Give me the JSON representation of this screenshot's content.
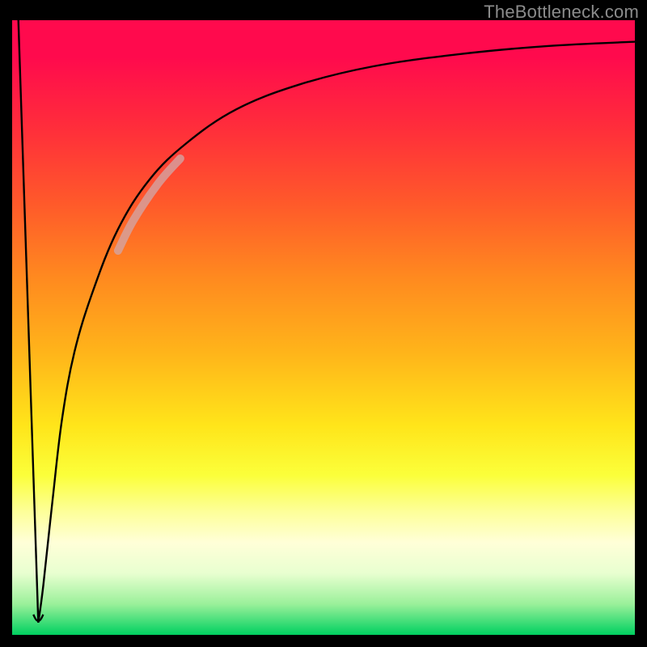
{
  "watermark": "TheBottleneck.com",
  "chart_data": {
    "type": "line",
    "title": "",
    "xlabel": "",
    "ylabel": "",
    "xlim": [
      0,
      100
    ],
    "ylim": [
      0,
      100
    ],
    "gradient_stops": [
      {
        "pct": 0,
        "color": "#ff0a4d"
      },
      {
        "pct": 6,
        "color": "#ff0a4d"
      },
      {
        "pct": 18,
        "color": "#ff2f3a"
      },
      {
        "pct": 30,
        "color": "#ff5a2a"
      },
      {
        "pct": 42,
        "color": "#ff8a1f"
      },
      {
        "pct": 54,
        "color": "#ffb41a"
      },
      {
        "pct": 66,
        "color": "#ffe51a"
      },
      {
        "pct": 74,
        "color": "#fbff3a"
      },
      {
        "pct": 80,
        "color": "#fdff9a"
      },
      {
        "pct": 85,
        "color": "#ffffd8"
      },
      {
        "pct": 90,
        "color": "#e8ffd0"
      },
      {
        "pct": 95,
        "color": "#9af09a"
      },
      {
        "pct": 100,
        "color": "#00d060"
      }
    ],
    "series": [
      {
        "name": "descending-edge",
        "stroke": "#000000",
        "width": 2.4,
        "points": [
          {
            "x": 1.0,
            "y": 100.0
          },
          {
            "x": 4.2,
            "y": 2.0
          }
        ]
      },
      {
        "name": "rising-curve",
        "stroke": "#000000",
        "width": 2.4,
        "points": [
          {
            "x": 4.2,
            "y": 2.0
          },
          {
            "x": 5.0,
            "y": 8.0
          },
          {
            "x": 6.5,
            "y": 22.0
          },
          {
            "x": 8.0,
            "y": 35.0
          },
          {
            "x": 10.0,
            "y": 46.0
          },
          {
            "x": 13.0,
            "y": 56.0
          },
          {
            "x": 17.0,
            "y": 66.0
          },
          {
            "x": 22.0,
            "y": 74.0
          },
          {
            "x": 28.0,
            "y": 80.0
          },
          {
            "x": 36.0,
            "y": 85.5
          },
          {
            "x": 46.0,
            "y": 89.5
          },
          {
            "x": 58.0,
            "y": 92.5
          },
          {
            "x": 72.0,
            "y": 94.5
          },
          {
            "x": 86.0,
            "y": 95.8
          },
          {
            "x": 100.0,
            "y": 96.5
          }
        ]
      },
      {
        "name": "highlight-segment",
        "stroke": "rgba(210,165,165,0.78)",
        "width": 10,
        "linecap": "round",
        "points": [
          {
            "x": 17.0,
            "y": 62.5
          },
          {
            "x": 19.5,
            "y": 67.5
          },
          {
            "x": 23.5,
            "y": 73.5
          },
          {
            "x": 27.0,
            "y": 77.5
          }
        ]
      }
    ],
    "notch": {
      "x": 4.2,
      "y": 2.0
    }
  }
}
